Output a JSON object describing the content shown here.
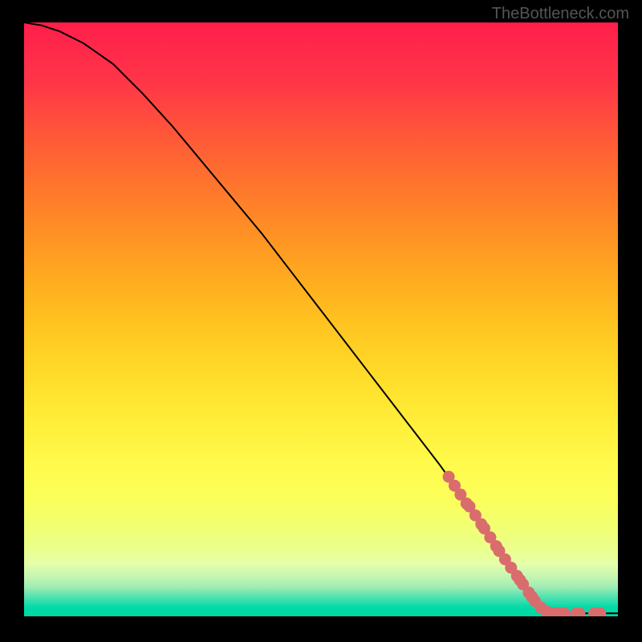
{
  "watermark": "TheBottleneck.com",
  "chart_data": {
    "type": "line",
    "title": "",
    "xlabel": "",
    "ylabel": "",
    "xlim": [
      0,
      100
    ],
    "ylim": [
      0,
      100
    ],
    "curve": {
      "x": [
        0,
        3,
        6,
        10,
        15,
        20,
        25,
        30,
        35,
        40,
        45,
        50,
        55,
        60,
        65,
        70,
        75,
        80,
        84,
        86,
        88,
        90,
        92,
        94,
        96,
        98,
        100
      ],
      "y": [
        100,
        99.5,
        98.5,
        96.5,
        93,
        88,
        82.5,
        76.5,
        70.5,
        64.5,
        58,
        51.5,
        45,
        38.5,
        32,
        25.5,
        18.5,
        11.5,
        5.5,
        3,
        1.2,
        0.6,
        0.5,
        0.5,
        0.5,
        0.5,
        0.5
      ]
    },
    "highlight_points": {
      "color": "#d96d6d",
      "points": [
        {
          "x": 71.5,
          "y": 23.5
        },
        {
          "x": 72.5,
          "y": 22
        },
        {
          "x": 73.5,
          "y": 20.5
        },
        {
          "x": 74.5,
          "y": 19
        },
        {
          "x": 75,
          "y": 18.5
        },
        {
          "x": 76,
          "y": 17
        },
        {
          "x": 77,
          "y": 15.5
        },
        {
          "x": 77.5,
          "y": 14.8
        },
        {
          "x": 78.5,
          "y": 13.3
        },
        {
          "x": 79.5,
          "y": 11.8
        },
        {
          "x": 80,
          "y": 11
        },
        {
          "x": 81,
          "y": 9.6
        },
        {
          "x": 82,
          "y": 8.2
        },
        {
          "x": 83,
          "y": 6.8
        },
        {
          "x": 83.5,
          "y": 6.1
        },
        {
          "x": 84,
          "y": 5.4
        },
        {
          "x": 85,
          "y": 4
        },
        {
          "x": 85.5,
          "y": 3.3
        },
        {
          "x": 86,
          "y": 2.6
        },
        {
          "x": 87,
          "y": 1.5
        },
        {
          "x": 88,
          "y": 0.8
        },
        {
          "x": 89,
          "y": 0.5
        },
        {
          "x": 89.5,
          "y": 0.5
        },
        {
          "x": 90,
          "y": 0.5
        },
        {
          "x": 90.5,
          "y": 0.5
        },
        {
          "x": 91,
          "y": 0.5
        },
        {
          "x": 93,
          "y": 0.5
        },
        {
          "x": 93.5,
          "y": 0.5
        },
        {
          "x": 96,
          "y": 0.5
        },
        {
          "x": 97,
          "y": 0.5
        }
      ]
    }
  }
}
